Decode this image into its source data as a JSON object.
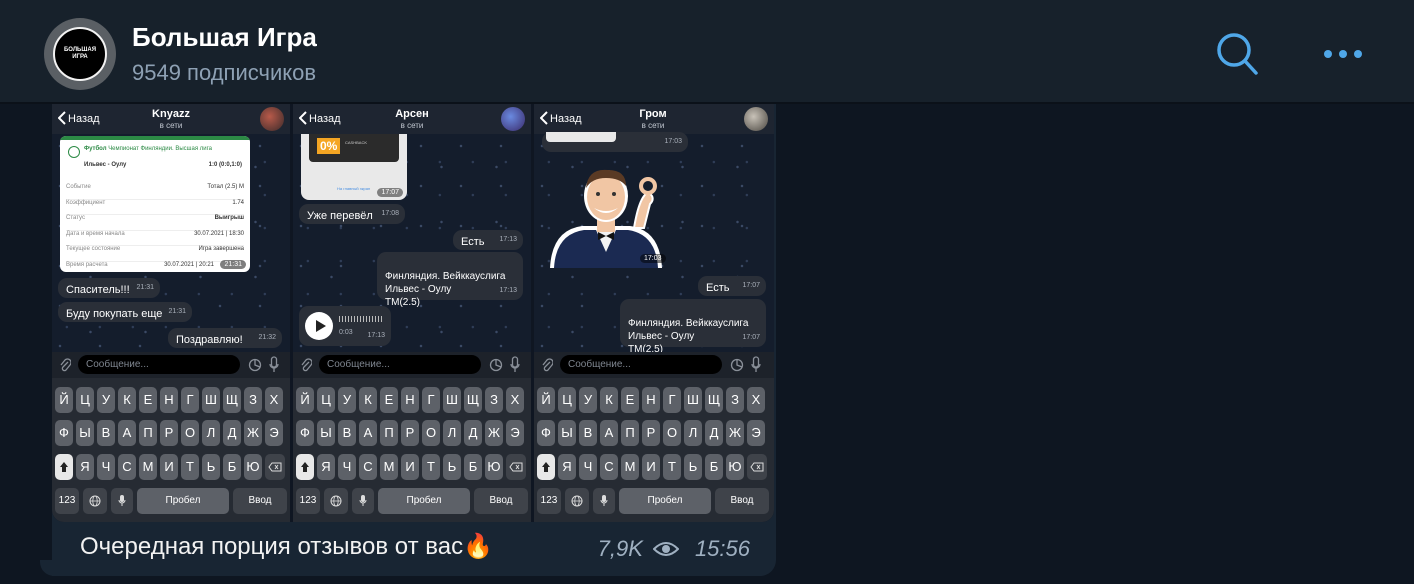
{
  "header": {
    "avatar_logo_text": "БОЛЬШАЯ\nИГРА",
    "title": "Большая Игра",
    "subscribers": "9549 подписчиков",
    "search_icon": "search-icon",
    "more_icon": "more-dots-icon",
    "accent": "#4fa7e8"
  },
  "post": {
    "caption": "Очередная порция отзывов от вас🔥",
    "views": "7,9K",
    "time": "15:56"
  },
  "phones": [
    {
      "back": "Назад",
      "name": "Knyazz",
      "status": "в сети",
      "bet_card": {
        "sport": "Футбол",
        "league": "Чемпионат Финляндии. Высшая лига",
        "match": "Ильвес - Оулу",
        "score": "1:0 (0:0,1:0)",
        "rows": [
          {
            "k": "Событие",
            "v": "Тотал (2.5) М"
          },
          {
            "k": "Коэффициент",
            "v": "1.74"
          },
          {
            "k": "Статус",
            "v": "Выигрыш"
          },
          {
            "k": "Дата и время начала",
            "v": "30.07.2021 | 18:30"
          },
          {
            "k": "Текущее состояние",
            "v": "Игра завершена"
          },
          {
            "k": "Время расчета",
            "v": "30.07.2021 | 20:21"
          }
        ],
        "time": "21:31"
      },
      "messages": [
        {
          "text": "Спаситель!!!",
          "time": "21:31"
        },
        {
          "text": "Буду покупать еще",
          "time": "21:31"
        },
        {
          "text": "Поздравляю!",
          "time": "21:32"
        }
      ]
    },
    {
      "back": "Назад",
      "name": "Арсен",
      "status": "в сети",
      "promo": {
        "big": "0%",
        "small": "CASHBACK",
        "link": "На главный экран",
        "time": "17:07"
      },
      "messages": [
        {
          "text": "Уже перевёл",
          "time": "17:08"
        },
        {
          "text": "Есть",
          "time": "17:13"
        },
        {
          "text": "Финляндия. Вейккауслига\nИльвес - Оулу\nТМ(2.5)",
          "time": "17:13"
        },
        {
          "text": "0:03",
          "time": "17:13"
        }
      ]
    },
    {
      "back": "Назад",
      "name": "Гром",
      "status": "в сети",
      "sticker_time": "17:03",
      "top_time": "17:03",
      "messages": [
        {
          "text": "Есть",
          "time": "17:07"
        },
        {
          "text": "Финляндия. Вейккауслига\nИльвес - Оулу\nТМ(2.5)",
          "time": "17:07"
        }
      ]
    }
  ],
  "composer": {
    "placeholder": "Сообщение..."
  },
  "keyboard": {
    "row1": [
      "Й",
      "Ц",
      "У",
      "К",
      "Е",
      "Н",
      "Г",
      "Ш",
      "Щ",
      "З",
      "Х"
    ],
    "row2": [
      "Ф",
      "Ы",
      "В",
      "А",
      "П",
      "Р",
      "О",
      "Л",
      "Д",
      "Ж",
      "Э"
    ],
    "row3": [
      "Я",
      "Ч",
      "С",
      "М",
      "И",
      "Т",
      "Ь",
      "Б",
      "Ю"
    ],
    "num": "123",
    "space": "Пробел",
    "enter": "Ввод"
  }
}
